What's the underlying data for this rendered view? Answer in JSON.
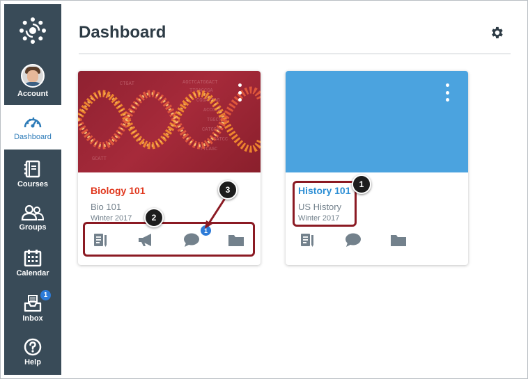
{
  "sidebar": {
    "items": [
      {
        "label": "Account",
        "icon": "avatar"
      },
      {
        "label": "Dashboard",
        "icon": "dashboard-icon",
        "active": true
      },
      {
        "label": "Courses",
        "icon": "courses-icon"
      },
      {
        "label": "Groups",
        "icon": "groups-icon"
      },
      {
        "label": "Calendar",
        "icon": "calendar-icon"
      },
      {
        "label": "Inbox",
        "icon": "inbox-icon",
        "badge": "1"
      },
      {
        "label": "Help",
        "icon": "help-icon"
      }
    ]
  },
  "header": {
    "title": "Dashboard",
    "settings_icon": "gear-icon"
  },
  "cards": [
    {
      "title": "Biology 101",
      "code": "Bio 101",
      "term": "Winter 2017",
      "title_color": "#e0361c",
      "actions": [
        "assignments-icon",
        "announcements-icon",
        "discussions-icon",
        "files-icon"
      ],
      "discussion_badge": "1"
    },
    {
      "title": "History 101",
      "code": "US History",
      "term": "Winter 2017",
      "title_color": "#2d8fd5",
      "hero_color": "#4ba3df",
      "actions": [
        "assignments-icon",
        "discussions-icon",
        "files-icon"
      ]
    }
  ],
  "callouts": [
    "1",
    "2",
    "3"
  ],
  "colors": {
    "sidebar_bg": "#394b58",
    "accent": "#2d7bb8",
    "callout_border": "#8b1a23"
  }
}
